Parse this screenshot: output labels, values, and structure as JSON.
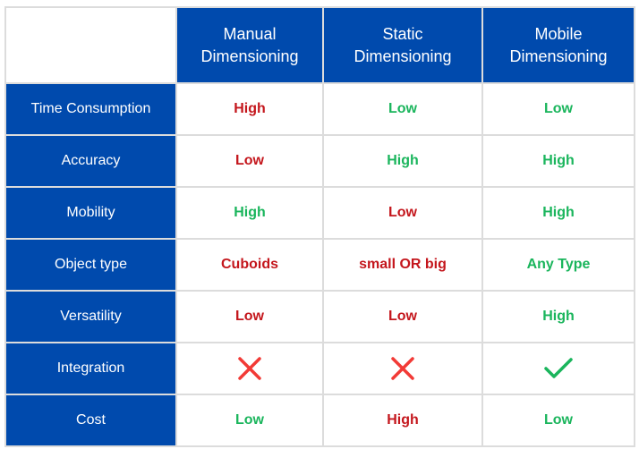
{
  "colors": {
    "header_bg": "#004aad",
    "negative": "#c4161c",
    "positive": "#1ab55c",
    "cross": "#f23a36",
    "check": "#1ab55c"
  },
  "columns": [
    "Manual\nDimensioning",
    "Static\nDimensioning",
    "Mobile\nDimensioning"
  ],
  "columns_lines": [
    [
      "Manual",
      "Dimensioning"
    ],
    [
      "Static",
      "Dimensioning"
    ],
    [
      "Mobile",
      "Dimensioning"
    ]
  ],
  "rows": [
    {
      "label": "Time Consumption",
      "cells": [
        {
          "text": "High",
          "tone": "negative"
        },
        {
          "text": "Low",
          "tone": "positive"
        },
        {
          "text": "Low",
          "tone": "positive"
        }
      ]
    },
    {
      "label": "Accuracy",
      "cells": [
        {
          "text": "Low",
          "tone": "negative"
        },
        {
          "text": "High",
          "tone": "positive"
        },
        {
          "text": "High",
          "tone": "positive"
        }
      ]
    },
    {
      "label": "Mobility",
      "cells": [
        {
          "text": "High",
          "tone": "positive"
        },
        {
          "text": "Low",
          "tone": "negative"
        },
        {
          "text": "High",
          "tone": "positive"
        }
      ]
    },
    {
      "label": "Object type",
      "cells": [
        {
          "text": "Cuboids",
          "tone": "negative"
        },
        {
          "text": "small OR big",
          "tone": "negative"
        },
        {
          "text": "Any Type",
          "tone": "positive"
        }
      ]
    },
    {
      "label": "Versatility",
      "cells": [
        {
          "text": "Low",
          "tone": "negative"
        },
        {
          "text": "Low",
          "tone": "negative"
        },
        {
          "text": "High",
          "tone": "positive"
        }
      ]
    },
    {
      "label": "Integration",
      "cells": [
        {
          "icon": "cross-icon",
          "tone": "negative"
        },
        {
          "icon": "cross-icon",
          "tone": "negative"
        },
        {
          "icon": "check-icon",
          "tone": "positive"
        }
      ]
    },
    {
      "label": "Cost",
      "cells": [
        {
          "text": "Low",
          "tone": "positive"
        },
        {
          "text": "High",
          "tone": "negative"
        },
        {
          "text": "Low",
          "tone": "positive"
        }
      ]
    }
  ]
}
